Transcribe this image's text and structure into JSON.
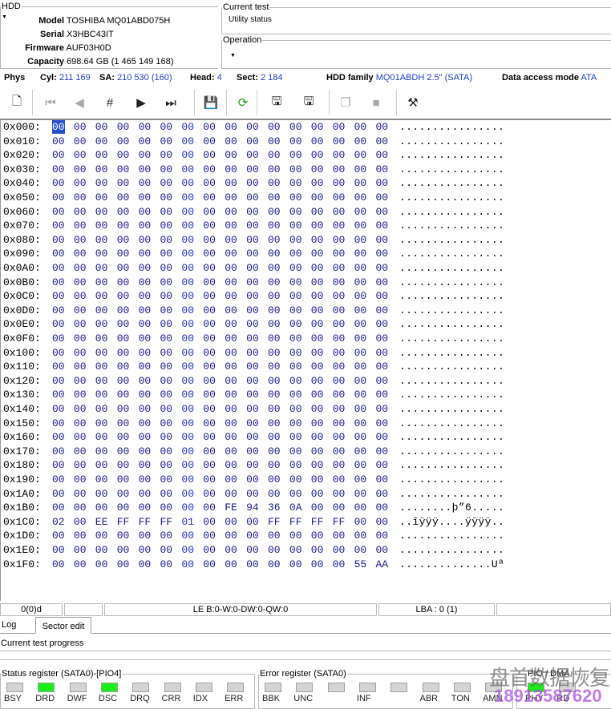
{
  "hdd": {
    "legend": "HDD",
    "model_label": "Model",
    "model": "TOSHIBA MQ01ABD075H",
    "serial_label": "Serial",
    "serial": "X3HBC43IT",
    "firmware_label": "Firmware",
    "firmware": "AUF03H0D",
    "capacity_label": "Capacity",
    "capacity": "698.64 GB (1 465 149 168)"
  },
  "current_test": {
    "legend": "Current test",
    "value": "Utility status"
  },
  "operation": {
    "legend": "Operation"
  },
  "phys": {
    "label": "Phys",
    "cyl_label": "Cyl:",
    "cyl": "211 169",
    "sa_label": "SA:",
    "sa": "210 530 (160)",
    "head_label": "Head:",
    "head": "4",
    "sect_label": "Sect:",
    "sect": "2 184",
    "family_label": "HDD family",
    "family": "MQ01ABDH 2.5\" (SATA)",
    "mode_label": "Data access mode",
    "mode": "ATA"
  },
  "toolbar": [
    "open-icon",
    "first-sector-icon",
    "prev-sector-icon",
    "goto-sector-icon",
    "next-sector-icon",
    "last-sector-icon",
    "save-icon",
    "refresh-icon",
    "save-to-file-icon",
    "load-from-file-icon",
    "copy-icon",
    "paste-icon",
    "tools-icon"
  ],
  "hex": {
    "cursor": "0x000:00",
    "rows": [
      {
        "o": "0x000:",
        "b": "00 00 00 00 00 00 00 00 00 00 00 00 00 00 00 00",
        "a": "................"
      },
      {
        "o": "0x010:",
        "b": "00 00 00 00 00 00 00 00 00 00 00 00 00 00 00 00",
        "a": "................"
      },
      {
        "o": "0x020:",
        "b": "00 00 00 00 00 00 00 00 00 00 00 00 00 00 00 00",
        "a": "................"
      },
      {
        "o": "0x030:",
        "b": "00 00 00 00 00 00 00 00 00 00 00 00 00 00 00 00",
        "a": "................"
      },
      {
        "o": "0x040:",
        "b": "00 00 00 00 00 00 00 00 00 00 00 00 00 00 00 00",
        "a": "................"
      },
      {
        "o": "0x050:",
        "b": "00 00 00 00 00 00 00 00 00 00 00 00 00 00 00 00",
        "a": "................"
      },
      {
        "o": "0x060:",
        "b": "00 00 00 00 00 00 00 00 00 00 00 00 00 00 00 00",
        "a": "................"
      },
      {
        "o": "0x070:",
        "b": "00 00 00 00 00 00 00 00 00 00 00 00 00 00 00 00",
        "a": "................"
      },
      {
        "o": "0x080:",
        "b": "00 00 00 00 00 00 00 00 00 00 00 00 00 00 00 00",
        "a": "................"
      },
      {
        "o": "0x090:",
        "b": "00 00 00 00 00 00 00 00 00 00 00 00 00 00 00 00",
        "a": "................"
      },
      {
        "o": "0x0A0:",
        "b": "00 00 00 00 00 00 00 00 00 00 00 00 00 00 00 00",
        "a": "................"
      },
      {
        "o": "0x0B0:",
        "b": "00 00 00 00 00 00 00 00 00 00 00 00 00 00 00 00",
        "a": "................"
      },
      {
        "o": "0x0C0:",
        "b": "00 00 00 00 00 00 00 00 00 00 00 00 00 00 00 00",
        "a": "................"
      },
      {
        "o": "0x0D0:",
        "b": "00 00 00 00 00 00 00 00 00 00 00 00 00 00 00 00",
        "a": "................"
      },
      {
        "o": "0x0E0:",
        "b": "00 00 00 00 00 00 00 00 00 00 00 00 00 00 00 00",
        "a": "................"
      },
      {
        "o": "0x0F0:",
        "b": "00 00 00 00 00 00 00 00 00 00 00 00 00 00 00 00",
        "a": "................"
      },
      {
        "o": "0x100:",
        "b": "00 00 00 00 00 00 00 00 00 00 00 00 00 00 00 00",
        "a": "................"
      },
      {
        "o": "0x110:",
        "b": "00 00 00 00 00 00 00 00 00 00 00 00 00 00 00 00",
        "a": "................"
      },
      {
        "o": "0x120:",
        "b": "00 00 00 00 00 00 00 00 00 00 00 00 00 00 00 00",
        "a": "................"
      },
      {
        "o": "0x130:",
        "b": "00 00 00 00 00 00 00 00 00 00 00 00 00 00 00 00",
        "a": "................"
      },
      {
        "o": "0x140:",
        "b": "00 00 00 00 00 00 00 00 00 00 00 00 00 00 00 00",
        "a": "................"
      },
      {
        "o": "0x150:",
        "b": "00 00 00 00 00 00 00 00 00 00 00 00 00 00 00 00",
        "a": "................"
      },
      {
        "o": "0x160:",
        "b": "00 00 00 00 00 00 00 00 00 00 00 00 00 00 00 00",
        "a": "................"
      },
      {
        "o": "0x170:",
        "b": "00 00 00 00 00 00 00 00 00 00 00 00 00 00 00 00",
        "a": "................"
      },
      {
        "o": "0x180:",
        "b": "00 00 00 00 00 00 00 00 00 00 00 00 00 00 00 00",
        "a": "................"
      },
      {
        "o": "0x190:",
        "b": "00 00 00 00 00 00 00 00 00 00 00 00 00 00 00 00",
        "a": "................"
      },
      {
        "o": "0x1A0:",
        "b": "00 00 00 00 00 00 00 00 00 00 00 00 00 00 00 00",
        "a": "................"
      },
      {
        "o": "0x1B0:",
        "b": "00 00 00 00 00 00 00 00 FE 94 36 0A 00 00 00 00",
        "a": "........þ”6....."
      },
      {
        "o": "0x1C0:",
        "b": "02 00 EE FF FF FF 01 00 00 00 FF FF FF FF 00 00",
        "a": "..îÿÿÿ....ÿÿÿÿ.."
      },
      {
        "o": "0x1D0:",
        "b": "00 00 00 00 00 00 00 00 00 00 00 00 00 00 00 00",
        "a": "................"
      },
      {
        "o": "0x1E0:",
        "b": "00 00 00 00 00 00 00 00 00 00 00 00 00 00 00 00",
        "a": "................"
      },
      {
        "o": "0x1F0:",
        "b": "00 00 00 00 00 00 00 00 00 00 00 00 00 00 55 AA",
        "a": "..............Uª"
      }
    ]
  },
  "statusbar": {
    "pos": "0(0)d",
    "le": "LE B:0-W:0-DW:0-QW:0",
    "lba": "LBA : 0 (1)"
  },
  "tabs": {
    "log": "Log",
    "sector_edit": "Sector edit"
  },
  "progress": {
    "label": "Current test progress",
    "value": 0
  },
  "status_register": {
    "legend": "Status register (SATA0)-[PIO4]",
    "leds": [
      {
        "n": "BSY",
        "on": false
      },
      {
        "n": "DRD",
        "on": true
      },
      {
        "n": "DWF",
        "on": false
      },
      {
        "n": "DSC",
        "on": true
      },
      {
        "n": "DRQ",
        "on": false
      },
      {
        "n": "CRR",
        "on": false
      },
      {
        "n": "IDX",
        "on": false
      },
      {
        "n": "ERR",
        "on": false
      }
    ]
  },
  "error_register": {
    "legend": "Error register (SATA0)",
    "leds": [
      {
        "n": "BBK",
        "on": false
      },
      {
        "n": "UNC",
        "on": false
      },
      {
        "n": "",
        "on": false
      },
      {
        "n": "INF",
        "on": false
      },
      {
        "n": "",
        "on": false
      },
      {
        "n": "ABR",
        "on": false
      },
      {
        "n": "TON",
        "on": false
      },
      {
        "n": "AMN",
        "on": false
      }
    ]
  },
  "mode_register": {
    "legend": "PIO / DMA",
    "leds": [
      {
        "n": "PHY",
        "on": true
      },
      {
        "n": "RD",
        "on": false
      }
    ]
  },
  "watermark": {
    "line1": "盘首数据恢复",
    "line2": "18913587620"
  },
  "colors": {
    "value_blue": "#1f3fbf",
    "led_on": "#19f019",
    "led_off": "#d4d4d4"
  }
}
